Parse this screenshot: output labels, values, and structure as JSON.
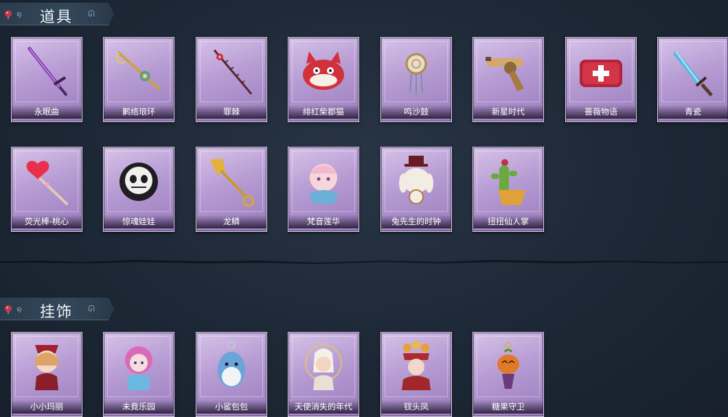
{
  "sections": [
    {
      "title": "道具",
      "items": [
        {
          "name": "永眠曲",
          "icon": "purple-sword-icon"
        },
        {
          "name": "鹣络琅环",
          "icon": "golden-scepter-icon"
        },
        {
          "name": "罪棘",
          "icon": "thorn-staff-icon"
        },
        {
          "name": "绯红柴郡猫",
          "icon": "red-cat-icon"
        },
        {
          "name": "鸣沙鼓",
          "icon": "dreamcatcher-drum-icon"
        },
        {
          "name": "新星时代",
          "icon": "revolver-icon"
        },
        {
          "name": "蔷薇物语",
          "icon": "medkit-icon"
        },
        {
          "name": "青瓷",
          "icon": "porcelain-dagger-icon"
        },
        {
          "name": "荧光棒-桃心",
          "icon": "heart-wand-icon"
        },
        {
          "name": "惊魂娃娃",
          "icon": "skull-doll-icon"
        },
        {
          "name": "龙鳞",
          "icon": "golden-shovel-icon"
        },
        {
          "name": "梵音莲华",
          "icon": "lotus-doll-icon"
        },
        {
          "name": "兔先生的时钟",
          "icon": "rabbit-clock-icon"
        },
        {
          "name": "扭扭仙人掌",
          "icon": "cactus-icon"
        }
      ]
    },
    {
      "title": "挂饰",
      "items": [
        {
          "name": "小小玛丽",
          "icon": "mary-doll-icon"
        },
        {
          "name": "未竟乐园",
          "icon": "pink-doll-icon"
        },
        {
          "name": "小鲨包包",
          "icon": "shark-bag-icon"
        },
        {
          "name": "天使消失的年代",
          "icon": "angel-doll-icon"
        },
        {
          "name": "钗头凤",
          "icon": "phoenix-doll-icon"
        },
        {
          "name": "糖果守卫",
          "icon": "pumpkin-guard-icon"
        }
      ]
    }
  ]
}
